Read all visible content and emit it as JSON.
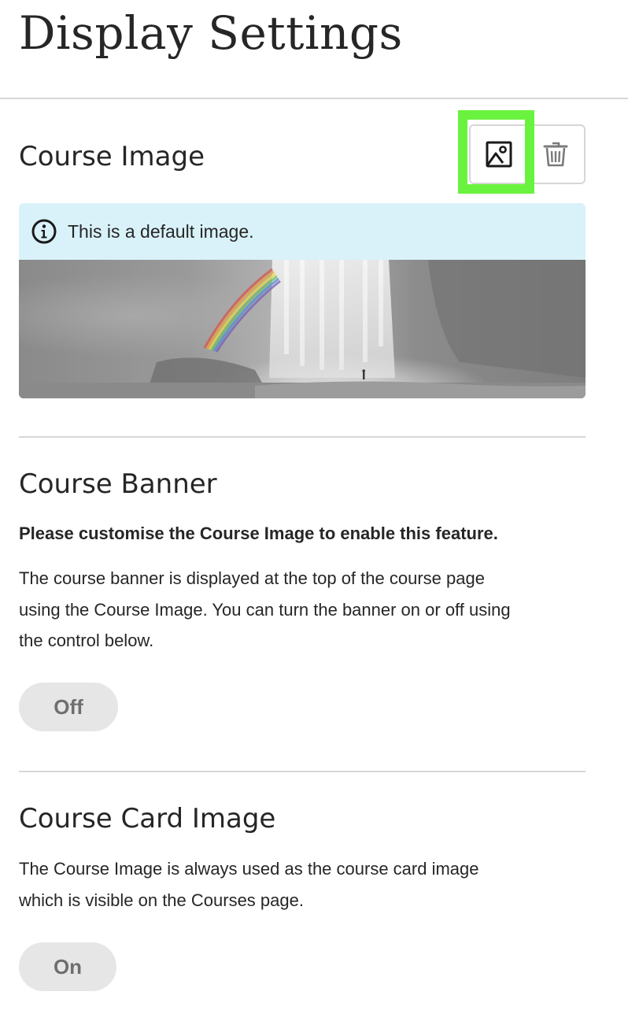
{
  "page": {
    "title": "Display Settings"
  },
  "course_image": {
    "heading": "Course Image",
    "info_text": "This is a default image.",
    "image_alt": "Waterfall with rainbow and a small figure standing at the base",
    "change_image_icon": "image-icon",
    "delete_icon": "trash-icon"
  },
  "course_banner": {
    "heading": "Course Banner",
    "note": "Please customise the Course Image to enable this feature.",
    "description_lines": [
      "The course banner is displayed at the top of the course page",
      "using the Course Image. You can turn the banner on or off using",
      "the control below."
    ],
    "toggle_label": "Off"
  },
  "course_card_image": {
    "heading": "Course Card Image",
    "description_lines": [
      "The Course Image is always used as the course card image",
      "which is visible on the Courses page."
    ],
    "toggle_label": "On"
  },
  "colors": {
    "info_background": "#d9f2fa",
    "highlight": "#6af33e",
    "toggle_background": "#e6e6e6",
    "divider": "#d6d6d6",
    "text": "#262626"
  }
}
